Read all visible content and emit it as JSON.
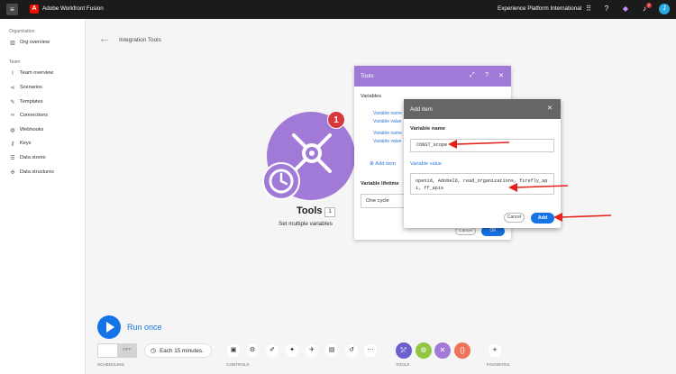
{
  "topbar": {
    "menu_icon": "hamburger-icon",
    "logo_text": "A",
    "app_title": "Adobe Workfront Fusion",
    "org_name": "Experience Platform International",
    "notification_count": "2",
    "avatar_initial": "J"
  },
  "sidebar": {
    "section_org": "Organization",
    "org_items": [
      {
        "label": "Org overview",
        "icon": "building-icon"
      }
    ],
    "section_team": "Team",
    "team_items": [
      {
        "label": "Team overview",
        "icon": "chart-icon"
      },
      {
        "label": "Scenarios",
        "icon": "share-icon"
      },
      {
        "label": "Templates",
        "icon": "template-icon"
      },
      {
        "label": "Connections",
        "icon": "link-icon"
      },
      {
        "label": "Webhooks",
        "icon": "globe-icon"
      },
      {
        "label": "Keys",
        "icon": "key-icon"
      },
      {
        "label": "Data stores",
        "icon": "database-icon"
      },
      {
        "label": "Data structures",
        "icon": "structure-icon"
      }
    ]
  },
  "header": {
    "breadcrumb": "Integration Tools"
  },
  "module": {
    "badge": "1",
    "title": "Tools",
    "count": "1",
    "subtitle": "Set multiple variables"
  },
  "tools_panel": {
    "title": "Tools",
    "variables_label": "Variables",
    "rows": [
      {
        "name": "Variable name",
        "value": "Variable value"
      },
      {
        "name": "Variable name",
        "value": "Variable value"
      }
    ],
    "add_item": "Add item",
    "lifetime_label": "Variable lifetime",
    "lifetime_value": "One cycle",
    "cancel": "Cancel",
    "ok": "OK"
  },
  "dialog": {
    "title": "Add item",
    "name_label": "Variable name",
    "name_value": "CONST_scope",
    "value_label": "Variable value",
    "value_text": "openid, AdobeID, read_organizations, firefly_api, ff_apis",
    "cancel": "Cancel",
    "add": "Add"
  },
  "bottom": {
    "run_once": "Run once",
    "toggle_state": "OFF",
    "schedule": "Each 15 minutes.",
    "labels": {
      "scheduling": "SCHEDULING",
      "controls": "CONTROLS",
      "tools": "TOOLS",
      "favorites": "FAVORITES"
    }
  },
  "colors": {
    "accent": "#1473e6",
    "tools": "#a17ad7",
    "annotation": "#e3231b"
  }
}
